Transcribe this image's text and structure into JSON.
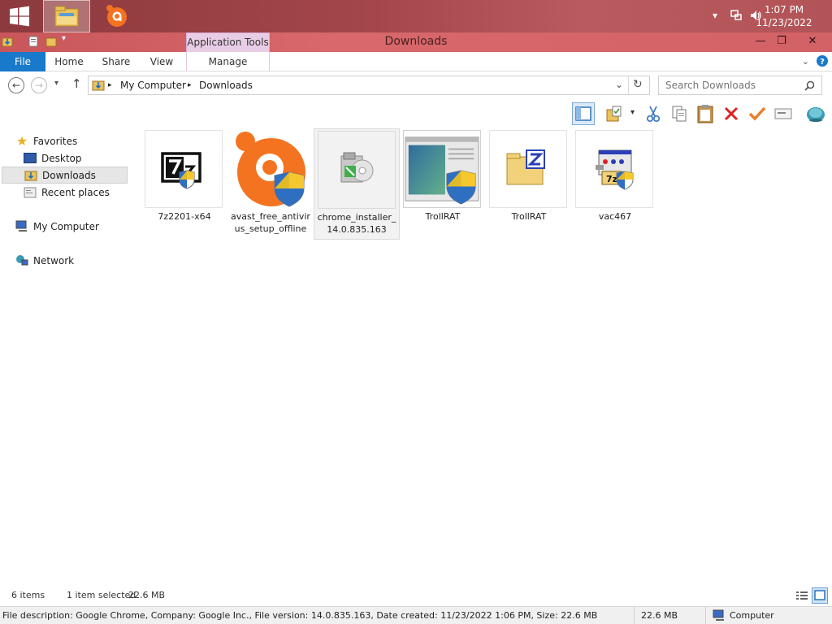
{
  "taskbar": {
    "time": "1:07 PM",
    "date": "11/23/2022",
    "apps": [
      "file-explorer-icon",
      "avast-icon"
    ]
  },
  "window": {
    "title": "Downloads",
    "context_tab": "Application Tools"
  },
  "ribbon": {
    "tabs": [
      "File",
      "Home",
      "Share",
      "View",
      "Manage"
    ]
  },
  "address": {
    "crumbs": [
      "My Computer",
      "Downloads"
    ],
    "search_placeholder": "Search Downloads"
  },
  "nav": {
    "favorites": "Favorites",
    "desktop": "Desktop",
    "downloads": "Downloads",
    "recent": "Recent places",
    "computer": "My Computer",
    "network": "Network"
  },
  "files": [
    {
      "name": "7z2201-x64",
      "icon": "7zip-icon",
      "selected": false
    },
    {
      "name": "avast_free_antivirus_setup_offline",
      "icon": "avast-icon",
      "selected": false
    },
    {
      "name": "chrome_installer_14.0.835.163",
      "icon": "installer-disc-icon",
      "selected": true
    },
    {
      "name": "TrollRAT",
      "icon": "window-app-icon",
      "selected": false
    },
    {
      "name": "TrollRAT",
      "icon": "zip-folder-icon",
      "selected": false
    },
    {
      "name": "vac467",
      "icon": "7z-setup-icon",
      "selected": false
    }
  ],
  "status": {
    "items": "6 items",
    "selected": "1 item selected",
    "size": "22.6 MB"
  },
  "info": {
    "description": "File description: Google Chrome, Company: Google Inc., File version: 14.0.835.163, Date created: 11/23/2022 1:06 PM, Size: 22.6 MB",
    "size": "22.6 MB",
    "location": "Computer"
  },
  "colors": {
    "taskbar": "#a4464a",
    "titlebar": "#d8686c",
    "file_tab": "#1979ca",
    "context_tab": "#e9cde6"
  }
}
